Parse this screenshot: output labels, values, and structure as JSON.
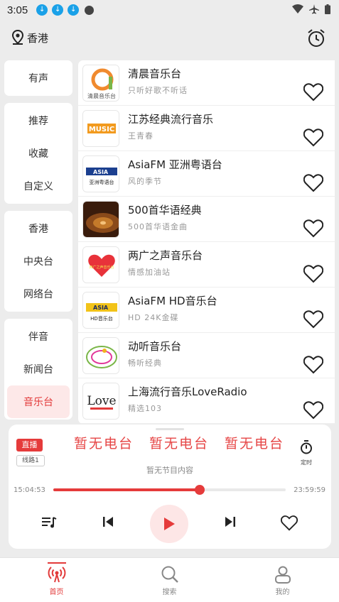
{
  "status_bar": {
    "time": "3:05"
  },
  "header": {
    "location": "香港"
  },
  "sidebar": {
    "groups": [
      [
        {
          "label": "有声"
        }
      ],
      [
        {
          "label": "推荐"
        },
        {
          "label": "收藏"
        },
        {
          "label": "自定义"
        }
      ],
      [
        {
          "label": "香港"
        },
        {
          "label": "中央台"
        },
        {
          "label": "网络台"
        }
      ],
      [
        {
          "label": "伴音"
        },
        {
          "label": "新闻台"
        },
        {
          "label": "音乐台",
          "active": true
        }
      ]
    ]
  },
  "stations": [
    {
      "name": "清晨音乐台",
      "desc": "只听好歌不听话",
      "logo_text": "清晨音乐台"
    },
    {
      "name": "江苏经典流行音乐",
      "desc": "王青春",
      "logo_text": "MUSIC"
    },
    {
      "name": "AsiaFM 亚洲粤语台",
      "desc": "风的季节",
      "logo_text": "亚洲粤语台"
    },
    {
      "name": "500首华语经典",
      "desc": "500首华语金曲",
      "logo_text": ""
    },
    {
      "name": "两广之声音乐台",
      "desc": "情感加油站",
      "logo_text": "两广之声音乐台"
    },
    {
      "name": "AsiaFM HD音乐台",
      "desc": "HD 24K金碟",
      "logo_text": "HD音乐台"
    },
    {
      "name": "动听音乐台",
      "desc": "畅听经典",
      "logo_text": ""
    },
    {
      "name": "上海流行音乐LoveRadio",
      "desc": "精选103",
      "logo_text": "Love"
    }
  ],
  "player": {
    "live_badge": "直播",
    "line_badge": "线路1",
    "marquee": [
      "暂无电台",
      "暂无电台",
      "暂无电台"
    ],
    "timer_label": "定时",
    "program": "暂无节目内容",
    "time_start": "15:04:53",
    "time_end": "23:59:59",
    "progress": 0.63
  },
  "bottom_nav": [
    {
      "label": "首页",
      "active": true
    },
    {
      "label": "搜索"
    },
    {
      "label": "我的"
    }
  ],
  "colors": {
    "accent": "#e53b3b",
    "active_bg": "#fde8e8"
  }
}
